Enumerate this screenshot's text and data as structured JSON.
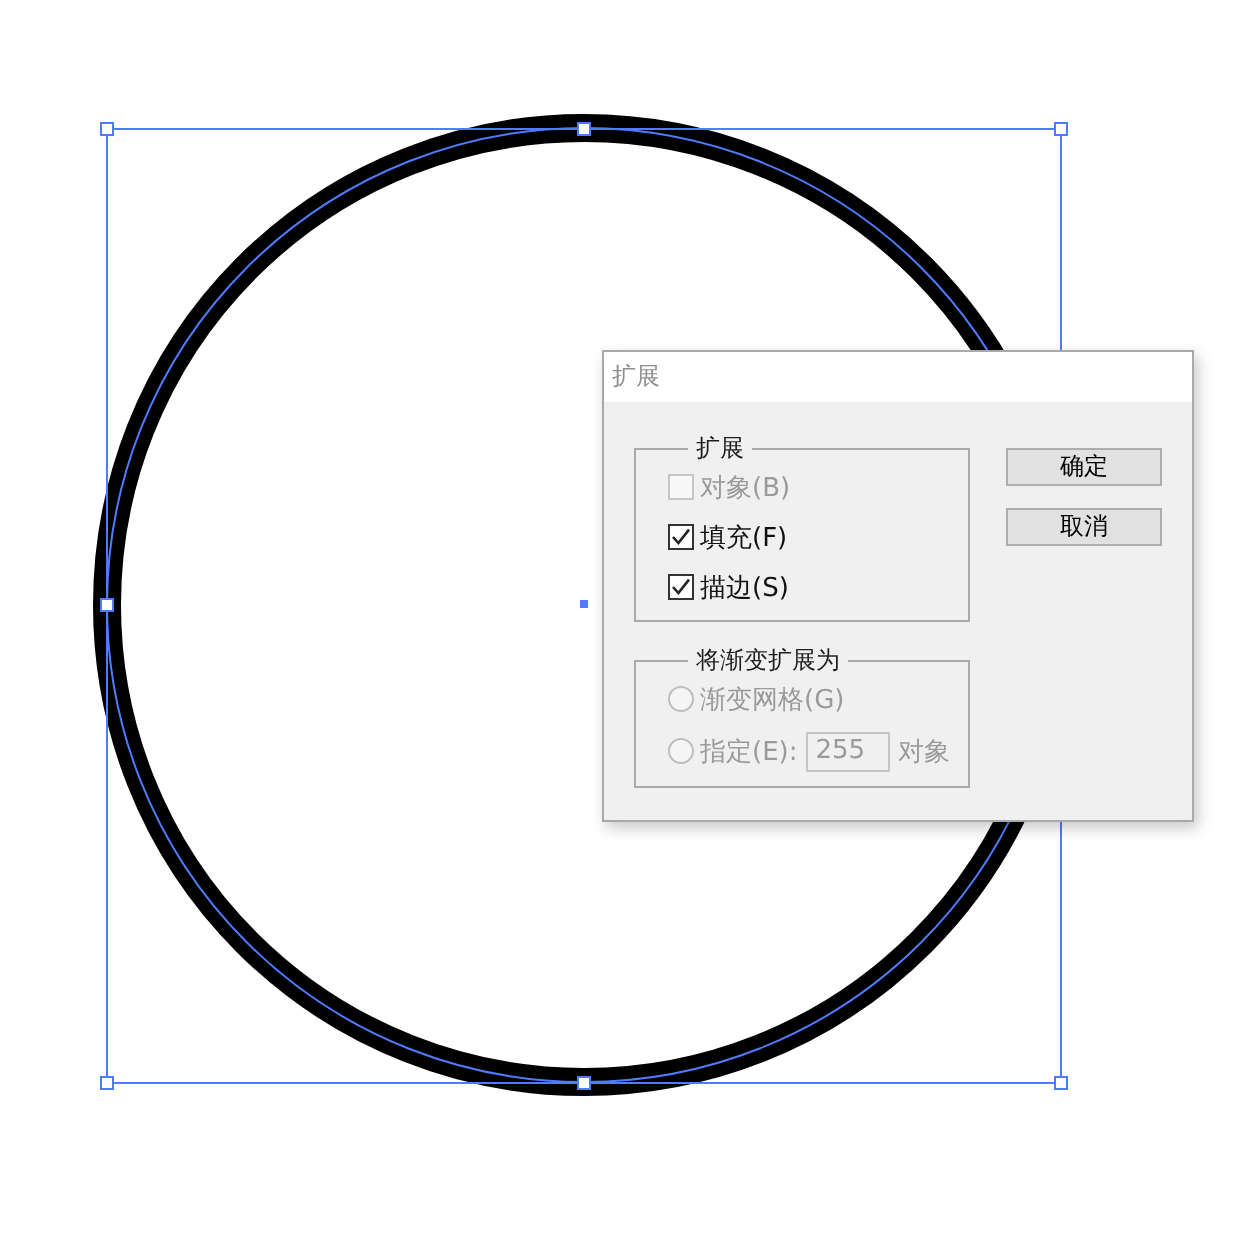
{
  "canvas": {
    "objects": [
      {
        "kind": "circle",
        "selected": true
      }
    ]
  },
  "dialog": {
    "title": "扩展",
    "groups": [
      {
        "legend": "扩展",
        "options": [
          {
            "kind": "checkbox",
            "label": "对象(B)",
            "checked": false,
            "disabled": true
          },
          {
            "kind": "checkbox",
            "label": "填充(F)",
            "checked": true,
            "disabled": false
          },
          {
            "kind": "checkbox",
            "label": "描边(S)",
            "checked": true,
            "disabled": false
          }
        ]
      },
      {
        "legend": "将渐变扩展为",
        "options": [
          {
            "kind": "radio",
            "label": "渐变网格(G)",
            "selected": false,
            "disabled": true
          },
          {
            "kind": "radio_field",
            "label": "指定(E):",
            "selected": false,
            "disabled": true,
            "value": "255",
            "suffix": "对象"
          }
        ]
      }
    ],
    "buttons": [
      {
        "label": "确定"
      },
      {
        "label": "取消"
      }
    ]
  }
}
